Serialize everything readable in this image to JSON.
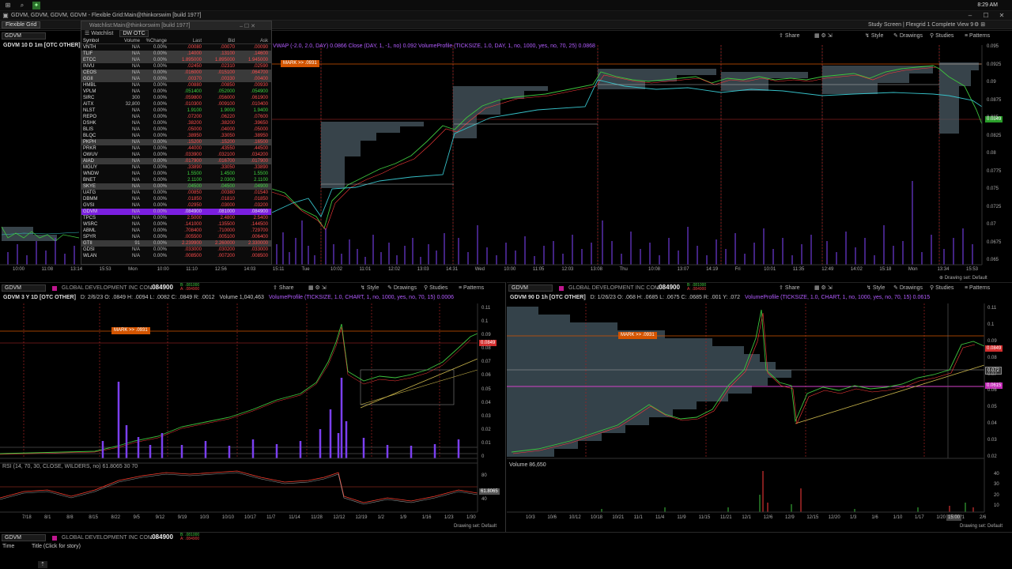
{
  "taskbar": {
    "time": "8:29 AM"
  },
  "window": {
    "title": "GDVM, GDVM, GDVM, GDVM - Flexible Grid:Main@thinkorswim [build 1977]"
  },
  "tabs": {
    "active": "Flexible Grid",
    "right_title": "Study Screen | Flexgrid 1 Complete View 9"
  },
  "toolbar": {
    "share": "Share",
    "style": "Style",
    "drawings": "Drawings",
    "studies": "Studies",
    "patterns": "Patterns",
    "drawing_set": "Drawing set: Default"
  },
  "chart1": {
    "symbol": "GDVM",
    "header": "GDVM 10 D 1m [OTC OTHER]",
    "studies": "VWAP (-2.0, 2.0, DAY) 0.0866  Close (DAY, 1, -1, no) 0.092  VolumeProfile (TICKSIZE, 1.0, DAY, 1, no, 1000, yes, no, 70, 25) 0.0868",
    "mark": "MARK >> .0931",
    "price_tag": "0.0849",
    "y_ticks": [
      "0.095",
      "0.0925",
      "0.09",
      "0.0875",
      "0.085",
      "0.0825",
      "0.08",
      "0.0775",
      "0.075",
      "0.0725",
      "0.07",
      "0.0675",
      "0.065"
    ],
    "x_ticks": [
      "10:00",
      "11:08",
      "13:14",
      "15:53",
      "Mon",
      "10:00",
      "11:10",
      "12:56",
      "14:03",
      "15:11",
      "Tue",
      "10:02",
      "11:01",
      "12:02",
      "13:03",
      "14:31",
      "Wed",
      "10:00",
      "11:05",
      "12:03",
      "13:08",
      "Thu",
      "10:08",
      "13:07",
      "14:19",
      "Fri",
      "10:01",
      "11:35",
      "12:49",
      "14:02",
      "15:18",
      "Mon",
      "13:34",
      "15:53"
    ]
  },
  "watchlist": {
    "title": "Watchlist:Main@thinkorswim [build 1977]",
    "name": "Watchlist",
    "list": "DW OTC",
    "columns": [
      "Symbol",
      "Volume",
      "%Change",
      "Last",
      "Bid",
      "Ask"
    ],
    "rows": [
      {
        "s": "VNTH",
        "v": "N/A",
        "c": "0.00%",
        "l": ".00080",
        "b": ".00070",
        "a": ".00090",
        "t": "dn"
      },
      {
        "s": "TLIF",
        "v": "N/A",
        "c": "0.00%",
        "l": ".14000",
        "b": ".13100",
        "a": ".14600",
        "t": "dn",
        "hl": true
      },
      {
        "s": "ETCC",
        "v": "N/A",
        "c": "0.00%",
        "l": "1.895000",
        "b": "1.895000",
        "a": "1.945000",
        "t": "dn",
        "hl": true
      },
      {
        "s": "INVU",
        "v": "N/A",
        "c": "0.00%",
        "l": ".02450",
        "b": ".02310",
        "a": ".02590",
        "t": "dn"
      },
      {
        "s": "CEOS",
        "v": "N/A",
        "c": "0.00%",
        "l": ".016000",
        "b": ".015100",
        "a": ".064700",
        "t": "dn",
        "hl": true
      },
      {
        "s": "GGII",
        "v": "N/A",
        "c": "0.00%",
        "l": ".00370",
        "b": ".00330",
        "a": ".00400",
        "t": "dn",
        "hl": true
      },
      {
        "s": "HMBL",
        "v": "N/A",
        "c": "0.00%",
        "l": ".00880",
        "b": ".00850",
        "a": ".00930",
        "t": "dn"
      },
      {
        "s": "VPLM",
        "v": "N/A",
        "c": "0.00%",
        "l": ".051400",
        "b": ".052000",
        "a": ".054900",
        "t": "up"
      },
      {
        "s": "SIRC",
        "v": "300",
        "c": "0.00%",
        "l": ".059800",
        "b": ".056000",
        "a": ".061900",
        "t": "dn"
      },
      {
        "s": "AITX",
        "v": "32,800",
        "c": "0.00%",
        "l": ".010300",
        "b": ".009100",
        "a": ".010400",
        "t": "dn"
      },
      {
        "s": "NLST",
        "v": "N/A",
        "c": "0.00%",
        "l": "1.9100",
        "b": "1.9000",
        "a": "1.9400",
        "t": "up"
      },
      {
        "s": "REPO",
        "v": "N/A",
        "c": "0.00%",
        "l": ".07200",
        "b": ".06220",
        "a": ".07600",
        "t": "dn"
      },
      {
        "s": "DSHK",
        "v": "N/A",
        "c": "0.00%",
        "l": ".38200",
        "b": ".38200",
        "a": ".39650",
        "t": "dn"
      },
      {
        "s": "BLIS",
        "v": "N/A",
        "c": "0.00%",
        "l": ".05000",
        "b": ".04000",
        "a": ".05000",
        "t": "dn"
      },
      {
        "s": "BLQC",
        "v": "N/A",
        "c": "0.00%",
        "l": ".38950",
        "b": ".33050",
        "a": ".38950",
        "t": "dn"
      },
      {
        "s": "PKPH",
        "v": "N/A",
        "c": "0.00%",
        "l": ".15200",
        "b": ".15200",
        "a": ".16500",
        "t": "dn",
        "hl": true
      },
      {
        "s": "PRKR",
        "v": "N/A",
        "c": "0.00%",
        "l": ".44000",
        "b": ".43550",
        "a": ".44500",
        "t": "dn"
      },
      {
        "s": "OWUV",
        "v": "N/A",
        "c": "0.00%",
        "l": ".033900",
        "b": ".032100",
        "a": ".034200",
        "t": "dn"
      },
      {
        "s": "AIAD",
        "v": "N/A",
        "c": "0.00%",
        "l": ".017900",
        "b": ".016700",
        "a": ".017900",
        "t": "dn",
        "hl": true
      },
      {
        "s": "MGUY",
        "v": "N/A",
        "c": "0.00%",
        "l": ".33890",
        "b": ".33050",
        "a": ".33890",
        "t": "dn"
      },
      {
        "s": "WNDW",
        "v": "N/A",
        "c": "0.00%",
        "l": "1.5500",
        "b": "1.4500",
        "a": "1.5500",
        "t": "up"
      },
      {
        "s": "BNET",
        "v": "N/A",
        "c": "0.00%",
        "l": "2.1100",
        "b": "2.0300",
        "a": "2.1100",
        "t": "up"
      },
      {
        "s": "SKYE",
        "v": "N/A",
        "c": "0.00%",
        "l": ".04500",
        "b": ".04500",
        "a": ".04900",
        "t": "up",
        "hl": true
      },
      {
        "s": "UATG",
        "v": "N/A",
        "c": "0.00%",
        "l": ".00850",
        "b": ".00380",
        "a": ".01540",
        "t": "dn"
      },
      {
        "s": "DBMM",
        "v": "N/A",
        "c": "0.00%",
        "l": ".01850",
        "b": ".01810",
        "a": ".01850",
        "t": "dn"
      },
      {
        "s": "GVSI",
        "v": "N/A",
        "c": "0.00%",
        "l": ".02950",
        "b": ".03000",
        "a": ".03200",
        "t": "dn"
      },
      {
        "s": "GDVM",
        "v": "N/A",
        "c": "0.00%",
        "l": ".084900",
        "b": ".081000",
        "a": ".084900",
        "t": "neu",
        "sel": true
      },
      {
        "s": "TPCS",
        "v": "N/A",
        "c": "0.00%",
        "l": "2.5000",
        "b": "2.4800",
        "a": "2.5400",
        "t": "dn"
      },
      {
        "s": "WSRC",
        "v": "N/A",
        "c": "0.00%",
        "l": ".141000",
        "b": ".135500",
        "a": ".144500",
        "t": "dn"
      },
      {
        "s": "ABML",
        "v": "N/A",
        "c": "0.00%",
        "l": ".708400",
        "b": ".710000",
        "a": ".729700",
        "t": "dn"
      },
      {
        "s": "SPYR",
        "v": "N/A",
        "c": "0.00%",
        "l": ".005500",
        "b": ".005100",
        "a": ".006400",
        "t": "dn"
      },
      {
        "s": "GTII",
        "v": "91",
        "c": "0.00%",
        "l": "2.239900",
        "b": "2.260000",
        "a": "2.330000",
        "t": "dn",
        "hl": true
      },
      {
        "s": "GDSI",
        "v": "N/A",
        "c": "0.00%",
        "l": ".033000",
        "b": ".030200",
        "a": ".033000",
        "t": "dn"
      },
      {
        "s": "WLAN",
        "v": "N/A",
        "c": "0.00%",
        "l": ".008500",
        "b": ".007200",
        "a": ".008500",
        "t": "dn"
      }
    ]
  },
  "chart2": {
    "symbol": "GDVM",
    "company": "GLOBAL DEVELOPMENT INC COM",
    "price": ".084900",
    "bid": "B: .081000",
    "ask": "A: .084900",
    "header": "GDVM 3 Y 1D [OTC OTHER]",
    "info": "D: 2/6/23  O: .0849  H: .0094  L: .0082  C: .0849  R: .0012",
    "volume": "Volume 1,040,463",
    "studies": "VolumeProfile (TICKSIZE, 1.0, CHART, 1, no, 1000, yes, no, 70, 15) 0.0006",
    "mark": "MARK >> .0931",
    "price_tag": "0.0849",
    "rsi_tag": "61.8065",
    "rsi": "RSI (14, 70, 30, CLOSE, WILDERS, no) 61.8065  30  70",
    "y_ticks": [
      "0.11",
      "0.1",
      "0.09",
      "0.08",
      "0.07",
      "0.06",
      "0.05",
      "0.04",
      "0.03",
      "0.02",
      "0.01",
      "0"
    ],
    "rsi_ticks": [
      "80",
      "40"
    ],
    "x_ticks": [
      "7/18",
      "8/1",
      "8/8",
      "8/15",
      "8/22",
      "9/5",
      "9/12",
      "9/19",
      "10/3",
      "10/10",
      "10/17",
      "11/7",
      "11/14",
      "11/28",
      "12/12",
      "12/19",
      "1/2",
      "1/9",
      "1/16",
      "1/23",
      "1/30"
    ]
  },
  "chart3": {
    "symbol": "GDVM",
    "company": "GLOBAL DEVELOPMENT INC COM",
    "price": ".084900",
    "bid": "B: .081000",
    "ask": "A: .084900",
    "header": "GDVM 90 D 1h [OTC OTHER]",
    "info": "D: 1/26/23  O: .068  H: .0685  L: .0675  C: .0685  R: .001  Y: .072",
    "studies": "VolumeProfile (TICKSIZE, 1.0, CHART, 1, no, 1000, yes, no, 70, 15) 0.0615",
    "mark": "MARK >> .0931",
    "price_tag": "0.0849",
    "tag2": "0.072",
    "tag3": "0.0615",
    "volume": "Volume 86,650",
    "y_ticks": [
      "0.11",
      "0.1",
      "0.09",
      "0.08",
      "0.07",
      "0.06",
      "0.05",
      "0.04",
      "0.03",
      "0.02"
    ],
    "vol_ticks": [
      "40",
      "30",
      "20",
      "10"
    ],
    "x_ticks": [
      "10/3",
      "10/6",
      "10/12",
      "10/18",
      "10/21",
      "11/1",
      "11/4",
      "11/9",
      "11/15",
      "11/21",
      "12/1",
      "12/6",
      "12/9",
      "12/15",
      "12/20",
      "1/3",
      "1/6",
      "1/10",
      "1/17",
      "1/20",
      "2/1",
      "2/6"
    ],
    "x_cursor": "15:00"
  },
  "bottom": {
    "symbol": "GDVM",
    "company": "GLOBAL DEVELOPMENT INC COM",
    "price": ".084900",
    "bid": "B: .081000",
    "ask": "A: .084900",
    "time": "Time",
    "story": "Title (Click for story)"
  }
}
